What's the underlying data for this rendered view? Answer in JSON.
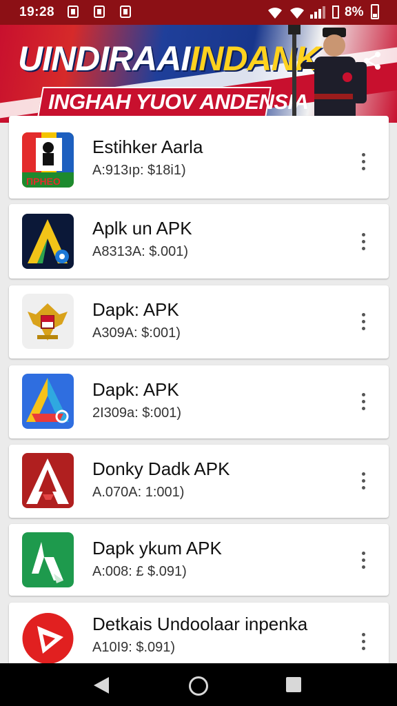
{
  "status_bar": {
    "time": "19:28",
    "battery_percent": "8%"
  },
  "banner": {
    "title_part1": "UINDIRAAI",
    "title_part2": "INDANK",
    "subtitle": "INGHAH YUOV ANDENSIA"
  },
  "apps": [
    {
      "name": "Estihker Aarla",
      "meta": "A:913ıр: $18i1)",
      "icon": "sticker-app-icon"
    },
    {
      "name": "Aplk un APK",
      "meta": "A8313A: $.001)",
      "icon": "apk-a-yellow-icon"
    },
    {
      "name": "Dapk: APK",
      "meta": "A309A: $:001)",
      "icon": "garuda-emblem-icon"
    },
    {
      "name": "Dapk: APK",
      "meta": "2I309а: $:001)",
      "icon": "drive-a-icon"
    },
    {
      "name": "Donky Dadk APK",
      "meta": "A.070A: 1:001)",
      "icon": "red-a-icon"
    },
    {
      "name": "Dapk ykum APK",
      "meta": "A:008: £ $.091)",
      "icon": "green-a-icon"
    },
    {
      "name": "Detkais Undoolaar inpenka",
      "meta": "A10I9: $.091)",
      "icon": "red-play-icon"
    }
  ],
  "colors": {
    "status_bar_bg": "#8c1015",
    "banner_red": "#c8102e",
    "banner_blue": "#1f3f9a",
    "banner_yellow": "#ffd21f",
    "list_bg": "#ebebeb"
  }
}
